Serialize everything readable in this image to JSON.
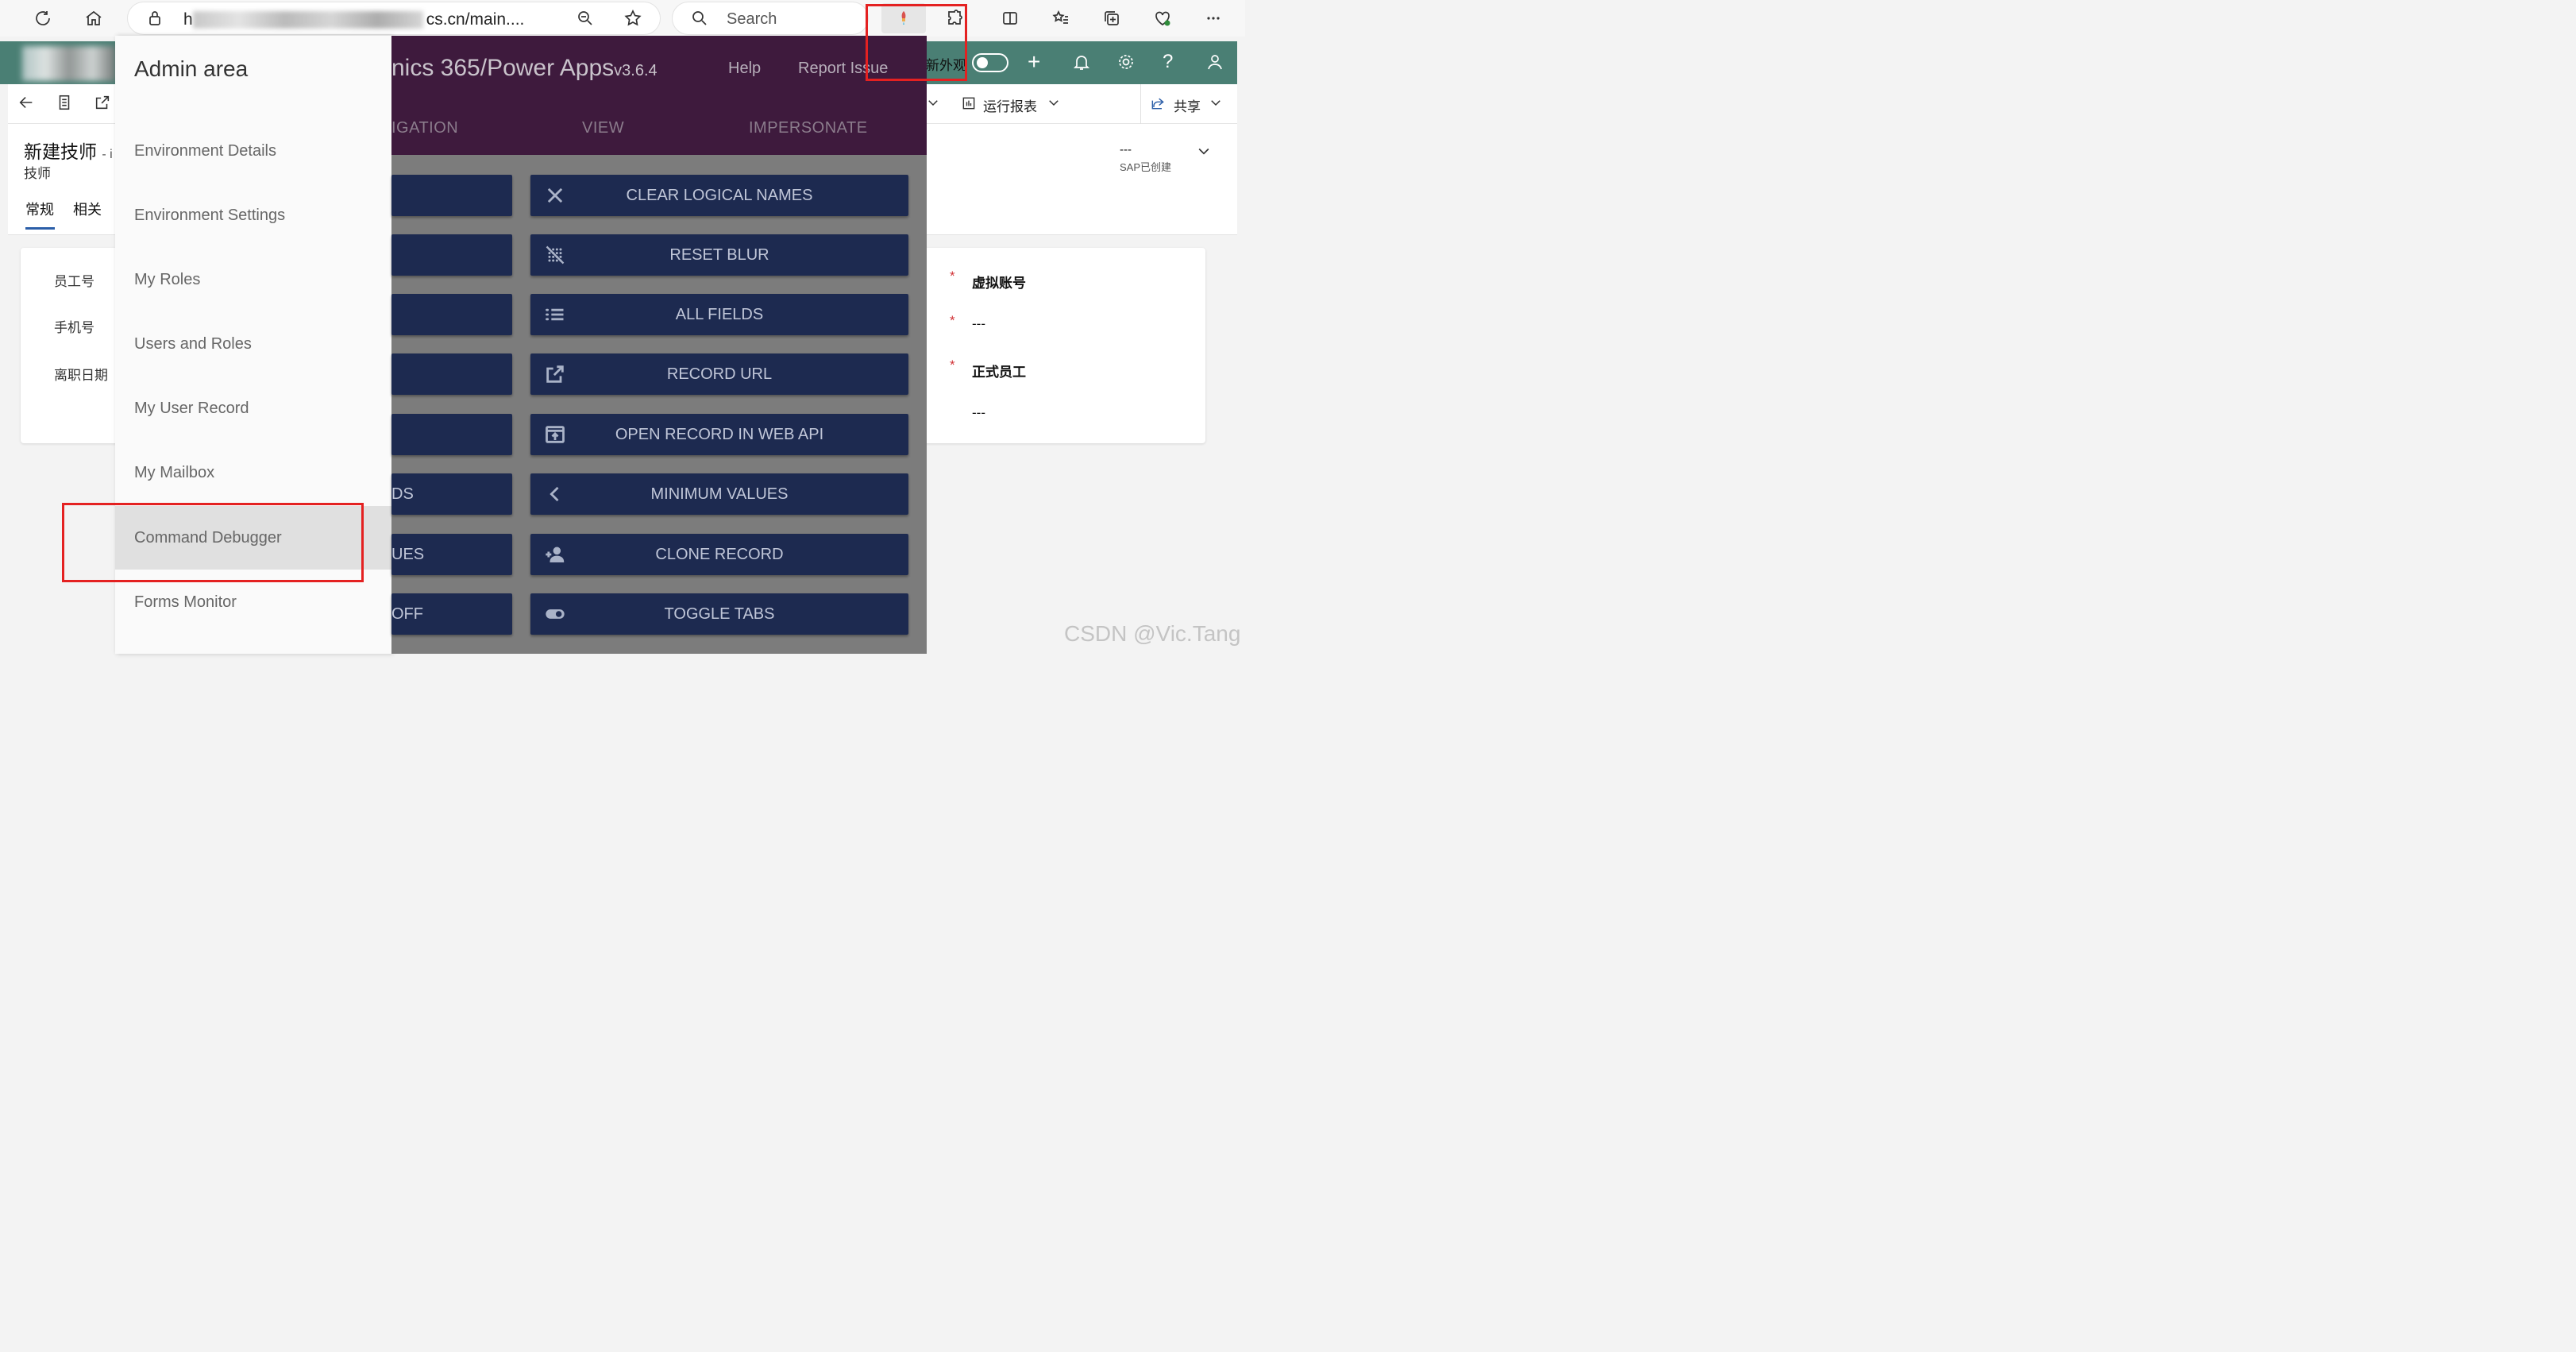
{
  "browser": {
    "url_suffix": "cs.cn/main....",
    "search_placeholder": "Search"
  },
  "app": {
    "new_appearance": "新外观",
    "run_report": "运行报表",
    "share": "共享",
    "record_title": "新建技师",
    "record_title_suffix": "- i",
    "record_subtitle": "技师",
    "tabs": [
      "常规",
      "相关"
    ],
    "header_field_value": "---",
    "header_field_label": "SAP已创建",
    "left_fields": [
      "员工号",
      "手机号",
      "离职日期"
    ],
    "right_fields": [
      {
        "label": "虚拟账号",
        "required": "*"
      },
      {
        "label": "---",
        "required": "*"
      },
      {
        "label": "正式员工",
        "required": "*"
      },
      {
        "label": "---",
        "required": ""
      }
    ]
  },
  "admin": {
    "title": "Admin area",
    "items": [
      "Environment Details",
      "Environment Settings",
      "My Roles",
      "Users and Roles",
      "My User Record",
      "My Mailbox",
      "Command Debugger",
      "Forms Monitor"
    ]
  },
  "levelup": {
    "title": "nics 365/Power Apps",
    "version": "v3.6.4",
    "help": "Help",
    "report_issue": "Report Issue",
    "tabs": [
      "IGATION",
      "VIEW",
      "IMPERSONATE"
    ],
    "left_buttons": [
      "",
      "",
      "",
      "",
      "",
      "DS",
      "UES",
      "OFF"
    ],
    "right_buttons": [
      {
        "label": "CLEAR LOGICAL NAMES",
        "icon": "close-icon"
      },
      {
        "label": "RESET BLUR",
        "icon": "blur-off-icon"
      },
      {
        "label": "ALL FIELDS",
        "icon": "list-icon"
      },
      {
        "label": "RECORD URL",
        "icon": "open-in-new-icon"
      },
      {
        "label": "OPEN RECORD IN WEB API",
        "icon": "open-in-browser-icon"
      },
      {
        "label": "MINIMUM VALUES",
        "icon": "chevron-left-icon"
      },
      {
        "label": "CLONE RECORD",
        "icon": "person-add-icon"
      },
      {
        "label": "TOGGLE TABS",
        "icon": "toggle-icon"
      }
    ]
  },
  "watermark": "CSDN @Vic.Tang"
}
